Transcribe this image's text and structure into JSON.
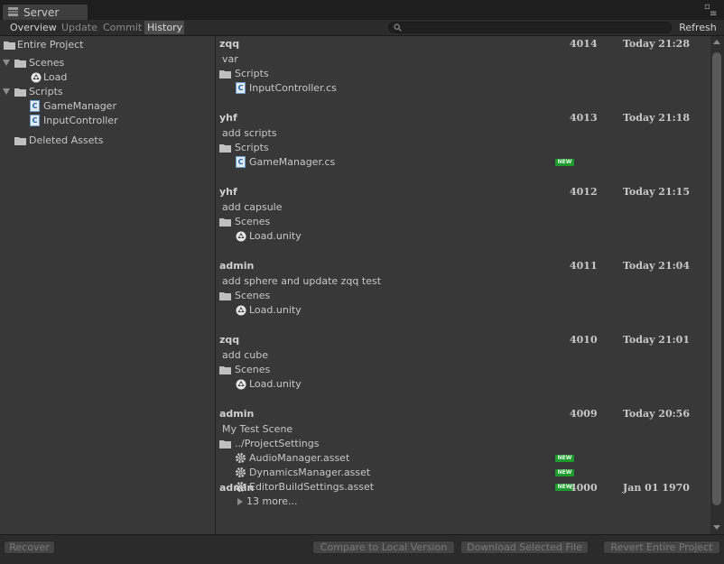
{
  "window": {
    "title": "Server"
  },
  "toolbar": {
    "tabs": [
      {
        "label": "Overview"
      },
      {
        "label": "Update"
      },
      {
        "label": "Commit"
      },
      {
        "label": "History"
      }
    ],
    "search_value": "",
    "refresh_label": "Refresh"
  },
  "tree": {
    "root_label": "Entire Project",
    "scenes_label": "Scenes",
    "scene_items": [
      "Load"
    ],
    "scripts_label": "Scripts",
    "script_items": [
      "GameManager",
      "InputController"
    ],
    "deleted_label": "Deleted Assets"
  },
  "history": [
    {
      "user": "zqq",
      "rev": "4014",
      "date": "Today 21:28",
      "message": "var",
      "folder": "Scripts",
      "files": [
        {
          "name": "InputController.cs",
          "icon": "cs-script-icon",
          "new": false
        }
      ]
    },
    {
      "user": "yhf",
      "rev": "4013",
      "date": "Today 21:18",
      "message": "add scripts",
      "folder": "Scripts",
      "files": [
        {
          "name": "GameManager.cs",
          "icon": "cs-script-icon",
          "new": true
        }
      ]
    },
    {
      "user": "yhf",
      "rev": "4012",
      "date": "Today 21:15",
      "message": "add capsule",
      "folder": "Scenes",
      "files": [
        {
          "name": "Load.unity",
          "icon": "unity-scene-icon",
          "new": false
        }
      ]
    },
    {
      "user": "admin",
      "rev": "4011",
      "date": "Today 21:04",
      "message": "add sphere and update zqq test",
      "folder": "Scenes",
      "files": [
        {
          "name": "Load.unity",
          "icon": "unity-scene-icon",
          "new": false
        }
      ]
    },
    {
      "user": "zqq",
      "rev": "4010",
      "date": "Today 21:01",
      "message": "add cube",
      "folder": "Scenes",
      "files": [
        {
          "name": "Load.unity",
          "icon": "unity-scene-icon",
          "new": false
        }
      ]
    },
    {
      "user": "admin",
      "rev": "4009",
      "date": "Today 20:56",
      "message": "My Test Scene",
      "folder": "../ProjectSettings",
      "files": [
        {
          "name": "AudioManager.asset",
          "icon": "gear-icon",
          "new": true
        },
        {
          "name": "DynamicsManager.asset",
          "icon": "gear-icon",
          "new": true
        },
        {
          "name": "EditorBuildSettings.asset",
          "icon": "gear-icon",
          "new": true
        }
      ],
      "more_label": "13 more..."
    },
    {
      "user": "admin",
      "rev": "4000",
      "date": "Jan 01 1970",
      "message": "",
      "folder": "",
      "files": []
    }
  ],
  "new_badge_label": "NEW",
  "bottom": {
    "recover": "Recover",
    "compare": "Compare to Local Version",
    "download": "Download Selected File",
    "revert": "Revert Entire Project"
  }
}
